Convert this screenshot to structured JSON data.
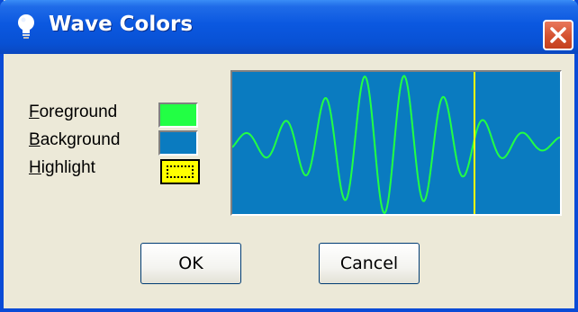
{
  "window": {
    "title": "Wave Colors",
    "title_icon": "lightbulb-icon",
    "close_icon": "close-icon"
  },
  "colors": {
    "items": [
      {
        "label_prefix": "",
        "accelerator": "F",
        "label_rest": "oreground",
        "color": "#22FF44"
      },
      {
        "label_prefix": "",
        "accelerator": "B",
        "label_rest": "ackground",
        "color": "#0A7BC0"
      },
      {
        "label_prefix": "",
        "accelerator": "H",
        "label_rest": "ighlight",
        "color": "#FFFF00"
      }
    ]
  },
  "preview": {
    "foreground": "#22FF44",
    "background": "#0A7BC0",
    "highlight": "#FFFF00",
    "highlight_position": 0.74
  },
  "buttons": {
    "ok_label": "OK",
    "cancel_label": "Cancel"
  }
}
